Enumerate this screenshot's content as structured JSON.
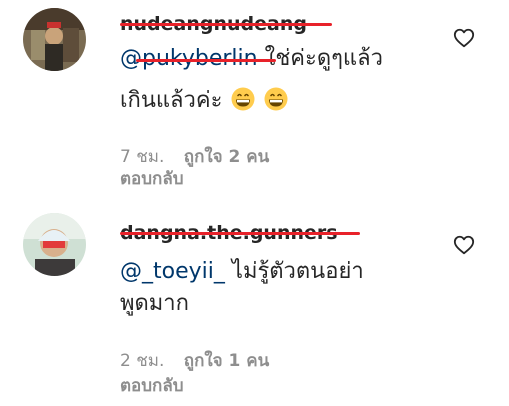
{
  "comments": [
    {
      "username": "nudeangnudeang",
      "mention": "@pukyberlin",
      "text_line1": "ใช่ค่ะดูๆแล้ว",
      "text_line2": "เกินแล้วค่ะ",
      "emoji": [
        "grinning-face-icon",
        "grinning-face-icon"
      ],
      "time": "7 ชม.",
      "likes": "ถูกใจ 2 คน",
      "reply": "ตอบกลับ"
    },
    {
      "username": "dangna.the.gunners",
      "mention": "@_toeyii_",
      "text_line1": "ไม่รู้ตัวตนอย่า",
      "text_line2": "พูดมาก",
      "time": "2 ชม.",
      "likes": "ถูกใจ 1 คน",
      "reply": "ตอบกลับ"
    }
  ],
  "colors": {
    "redaction": "#e8222a",
    "mention": "#00376b",
    "meta": "#8e8e8e",
    "text": "#262626"
  }
}
